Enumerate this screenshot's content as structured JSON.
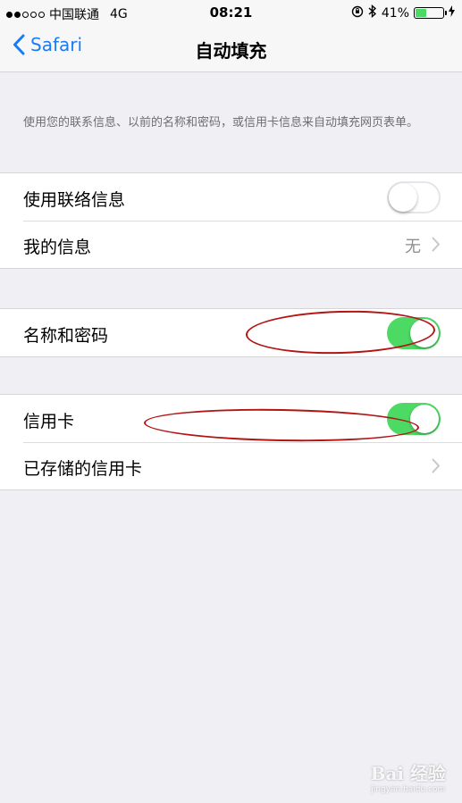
{
  "status_bar": {
    "carrier": "中国联通",
    "network": "4G",
    "time": "08:21",
    "battery_percent": "41%",
    "battery_level": 0.41
  },
  "nav": {
    "back_label": "Safari",
    "title": "自动填充"
  },
  "description": "使用您的联系信息、以前的名称和密码，或信用卡信息来自动填充网页表单。",
  "contact_group": {
    "use_contact_info": {
      "label": "使用联络信息",
      "on": false
    },
    "my_info": {
      "label": "我的信息",
      "value": "无"
    }
  },
  "names_group": {
    "names_passwords": {
      "label": "名称和密码",
      "on": true
    }
  },
  "card_group": {
    "credit_cards": {
      "label": "信用卡",
      "on": true
    },
    "saved_cards": {
      "label": "已存储的信用卡"
    }
  },
  "watermark": {
    "main": "Bai 经验",
    "sub": "jingyan.baidu.com"
  },
  "colors": {
    "accent": "#1a7cf5",
    "switch_on": "#4cd964",
    "annotation": "#b31414",
    "background": "#efeff4"
  }
}
